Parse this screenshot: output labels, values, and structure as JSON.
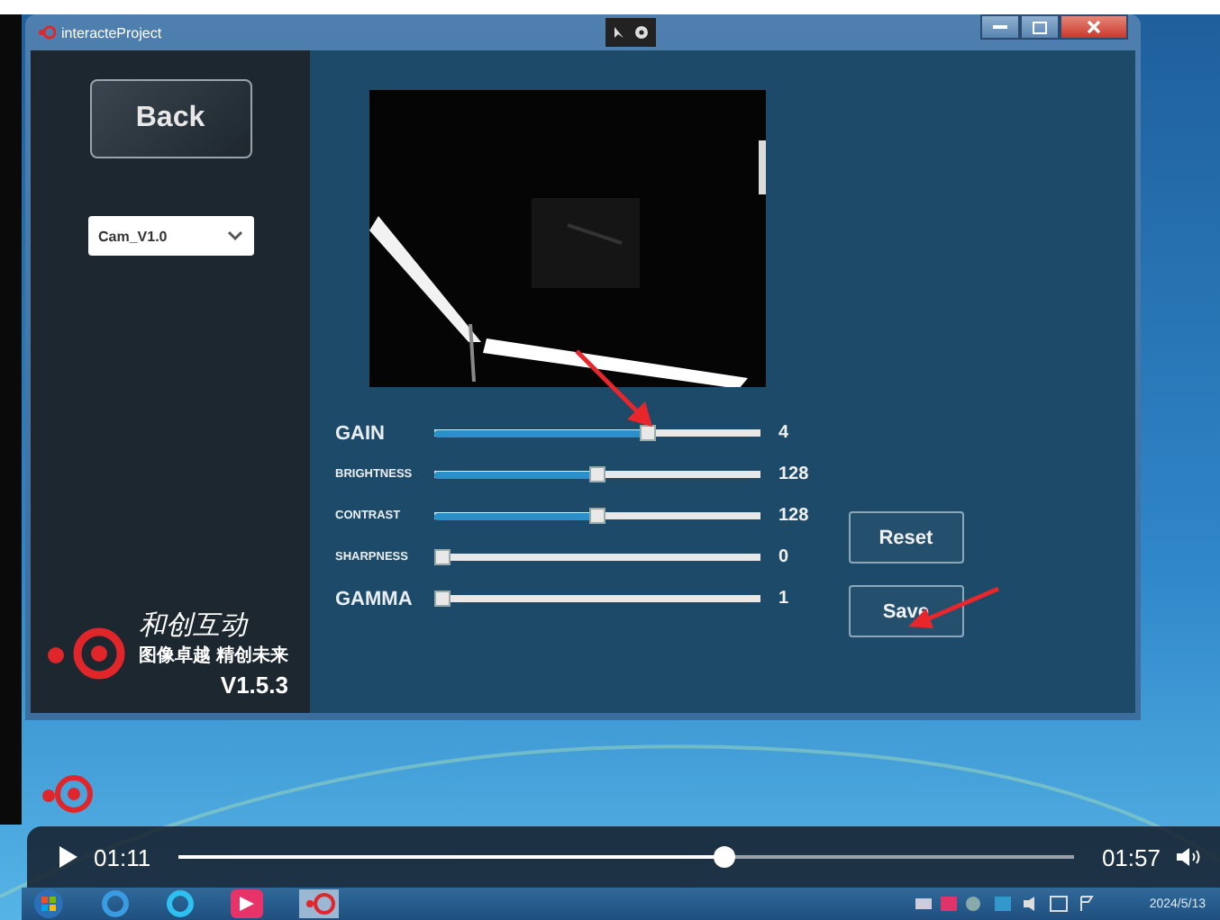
{
  "window": {
    "title": "interacteProject"
  },
  "sidebar": {
    "back_button": "Back",
    "camera_select": {
      "value": "Cam_V1.0"
    },
    "brand": {
      "name": "和创互动",
      "slogan": "图像卓越 精创未来",
      "version": "V1.5.3"
    }
  },
  "sliders": [
    {
      "kind": "large",
      "label": "GAIN",
      "level": 0.66,
      "reading": "4"
    },
    {
      "kind": "small",
      "label": "BRIGHTNESS",
      "level": 0.5,
      "reading": "128"
    },
    {
      "kind": "small",
      "label": "CONTRAST",
      "level": 0.5,
      "reading": "128"
    },
    {
      "kind": "small",
      "label": "SHARPNESS",
      "level": 0,
      "reading": "0"
    },
    {
      "kind": "large",
      "label": "GAMMA",
      "level": 0,
      "reading": "1"
    }
  ],
  "buttons": [
    "Reset",
    "Save"
  ],
  "player": {
    "elapsed": "01:11",
    "duration": "01:57",
    "level": 0.61
  },
  "taskbar": {
    "date": "2024/5/13"
  }
}
